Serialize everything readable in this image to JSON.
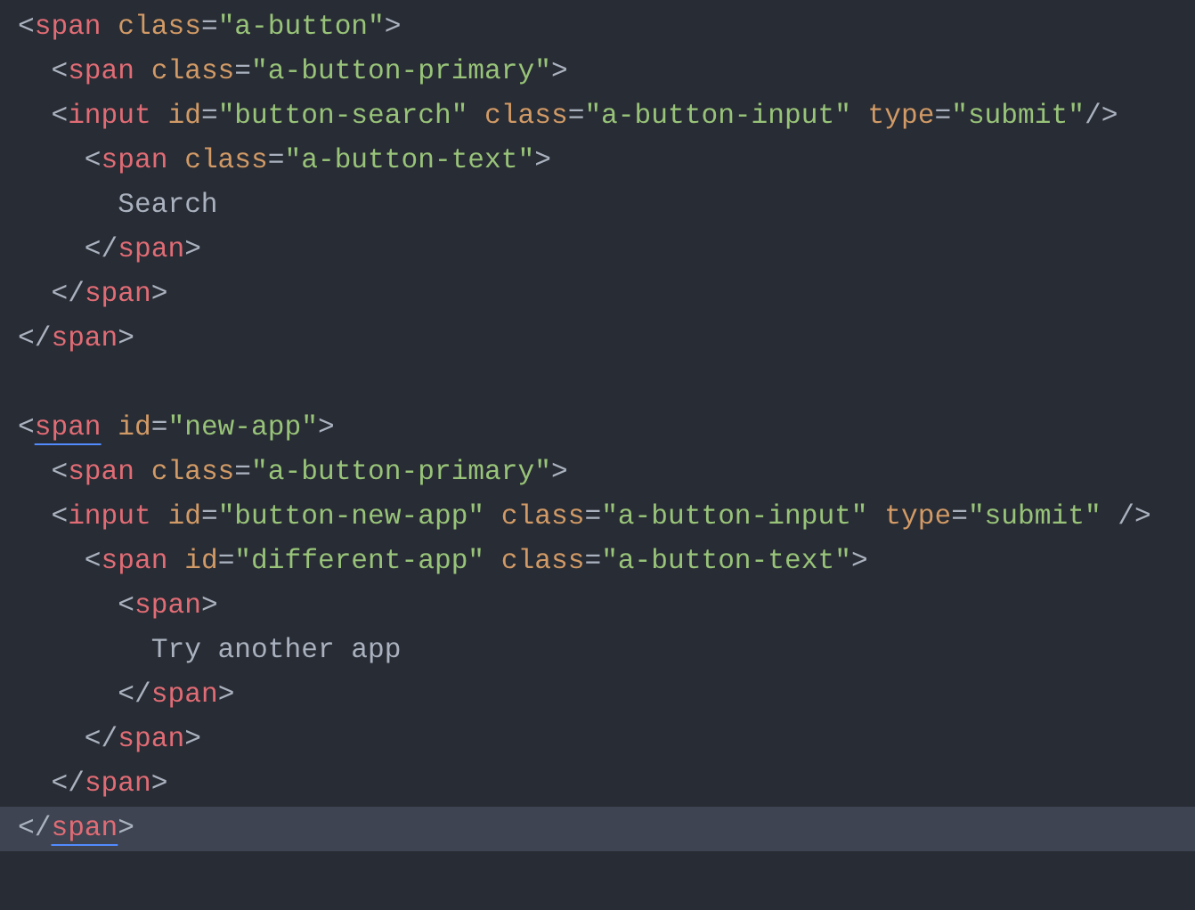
{
  "editor": {
    "lines": [
      {
        "current": false,
        "tokens": [
          {
            "kind": "punct",
            "text": "<"
          },
          {
            "kind": "tag",
            "text": "span"
          },
          {
            "kind": "attr",
            "text": " class"
          },
          {
            "kind": "punct",
            "text": "="
          },
          {
            "kind": "string",
            "text": "\"a-button\""
          },
          {
            "kind": "punct",
            "text": ">"
          }
        ]
      },
      {
        "current": false,
        "tokens": [
          {
            "kind": "punct",
            "text": "  <"
          },
          {
            "kind": "tag",
            "text": "span"
          },
          {
            "kind": "attr",
            "text": " class"
          },
          {
            "kind": "punct",
            "text": "="
          },
          {
            "kind": "string",
            "text": "\"a-button-primary\""
          },
          {
            "kind": "punct",
            "text": ">"
          }
        ]
      },
      {
        "current": false,
        "tokens": [
          {
            "kind": "punct",
            "text": "  <"
          },
          {
            "kind": "tag",
            "text": "input"
          },
          {
            "kind": "attr",
            "text": " id"
          },
          {
            "kind": "punct",
            "text": "="
          },
          {
            "kind": "string",
            "text": "\"button-search\""
          },
          {
            "kind": "attr",
            "text": " class"
          },
          {
            "kind": "punct",
            "text": "="
          },
          {
            "kind": "string",
            "text": "\"a-button-input\""
          },
          {
            "kind": "attr",
            "text": " type"
          },
          {
            "kind": "punct",
            "text": "="
          },
          {
            "kind": "string",
            "text": "\"submit\""
          },
          {
            "kind": "punct",
            "text": "/>"
          }
        ]
      },
      {
        "current": false,
        "tokens": [
          {
            "kind": "punct",
            "text": "    <"
          },
          {
            "kind": "tag",
            "text": "span"
          },
          {
            "kind": "attr",
            "text": " class"
          },
          {
            "kind": "punct",
            "text": "="
          },
          {
            "kind": "string",
            "text": "\"a-button-text\""
          },
          {
            "kind": "punct",
            "text": ">"
          }
        ]
      },
      {
        "current": false,
        "tokens": [
          {
            "kind": "text",
            "text": "      Search"
          }
        ]
      },
      {
        "current": false,
        "tokens": [
          {
            "kind": "punct",
            "text": "    </"
          },
          {
            "kind": "tag",
            "text": "span"
          },
          {
            "kind": "punct",
            "text": ">"
          }
        ]
      },
      {
        "current": false,
        "tokens": [
          {
            "kind": "punct",
            "text": "  </"
          },
          {
            "kind": "tag",
            "text": "span"
          },
          {
            "kind": "punct",
            "text": ">"
          }
        ]
      },
      {
        "current": false,
        "tokens": [
          {
            "kind": "punct",
            "text": "</"
          },
          {
            "kind": "tag",
            "text": "span"
          },
          {
            "kind": "punct",
            "text": ">"
          }
        ]
      },
      {
        "current": false
      },
      {
        "current": false,
        "tokens": [
          {
            "kind": "punct",
            "text": "<"
          },
          {
            "kind": "tag",
            "text": "span",
            "underlined": true
          },
          {
            "kind": "attr",
            "text": " id"
          },
          {
            "kind": "punct",
            "text": "="
          },
          {
            "kind": "string",
            "text": "\"new-app\""
          },
          {
            "kind": "punct",
            "text": ">"
          }
        ]
      },
      {
        "current": false,
        "tokens": [
          {
            "kind": "punct",
            "text": "  <"
          },
          {
            "kind": "tag",
            "text": "span"
          },
          {
            "kind": "attr",
            "text": " class"
          },
          {
            "kind": "punct",
            "text": "="
          },
          {
            "kind": "string",
            "text": "\"a-button-primary\""
          },
          {
            "kind": "punct",
            "text": ">"
          }
        ]
      },
      {
        "current": false,
        "tokens": [
          {
            "kind": "punct",
            "text": "  <"
          },
          {
            "kind": "tag",
            "text": "input"
          },
          {
            "kind": "attr",
            "text": " id"
          },
          {
            "kind": "punct",
            "text": "="
          },
          {
            "kind": "string",
            "text": "\"button-new-app\""
          },
          {
            "kind": "attr",
            "text": " class"
          },
          {
            "kind": "punct",
            "text": "="
          },
          {
            "kind": "string",
            "text": "\"a-button-input\""
          },
          {
            "kind": "attr",
            "text": " type"
          },
          {
            "kind": "punct",
            "text": "="
          },
          {
            "kind": "string",
            "text": "\"submit\""
          },
          {
            "kind": "punct",
            "text": " />"
          }
        ]
      },
      {
        "current": false,
        "tokens": [
          {
            "kind": "punct",
            "text": "    <"
          },
          {
            "kind": "tag",
            "text": "span"
          },
          {
            "kind": "attr",
            "text": " id"
          },
          {
            "kind": "punct",
            "text": "="
          },
          {
            "kind": "string",
            "text": "\"different-app\""
          },
          {
            "kind": "attr",
            "text": " class"
          },
          {
            "kind": "punct",
            "text": "="
          },
          {
            "kind": "string",
            "text": "\"a-button-text\""
          },
          {
            "kind": "punct",
            "text": ">"
          }
        ]
      },
      {
        "current": false,
        "tokens": [
          {
            "kind": "punct",
            "text": "      <"
          },
          {
            "kind": "tag",
            "text": "span"
          },
          {
            "kind": "punct",
            "text": ">"
          }
        ]
      },
      {
        "current": false,
        "tokens": [
          {
            "kind": "text",
            "text": "        Try another app"
          }
        ]
      },
      {
        "current": false,
        "tokens": [
          {
            "kind": "punct",
            "text": "      </"
          },
          {
            "kind": "tag",
            "text": "span"
          },
          {
            "kind": "punct",
            "text": ">"
          }
        ]
      },
      {
        "current": false,
        "tokens": [
          {
            "kind": "punct",
            "text": "    </"
          },
          {
            "kind": "tag",
            "text": "span"
          },
          {
            "kind": "punct",
            "text": ">"
          }
        ]
      },
      {
        "current": false,
        "tokens": [
          {
            "kind": "punct",
            "text": "  </"
          },
          {
            "kind": "tag",
            "text": "span"
          },
          {
            "kind": "punct",
            "text": ">"
          }
        ]
      },
      {
        "current": true,
        "tokens": [
          {
            "kind": "punct",
            "text": "</"
          },
          {
            "kind": "tag",
            "text": "span",
            "underlined": true
          },
          {
            "kind": "punct",
            "text": ">"
          }
        ]
      }
    ]
  }
}
